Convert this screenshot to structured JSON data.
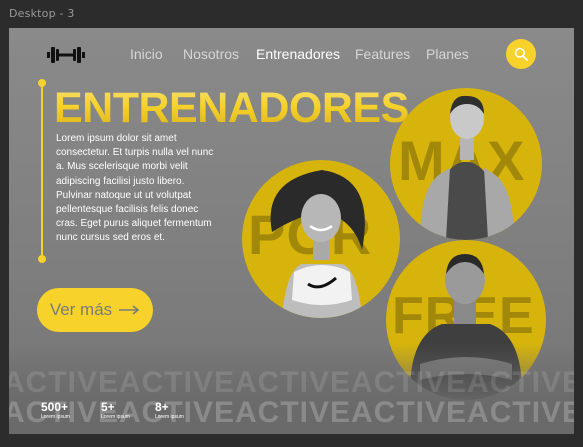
{
  "frame_label": "Desktop - 3",
  "colors": {
    "accent": "#f7d22a",
    "circle": "#d6b40c",
    "background": "#808080"
  },
  "header": {
    "logo_icon": "dumbbell-icon",
    "nav": [
      {
        "label": "Inicio"
      },
      {
        "label": "Nosotros"
      },
      {
        "label": "Entrenadores",
        "active": true
      },
      {
        "label": "Features"
      },
      {
        "label": "Planes"
      }
    ],
    "search_icon": "search-icon"
  },
  "hero": {
    "title": "ENTRENADORES",
    "body": "Lorem ipsum dolor sit amet consectetur. Et turpis nulla vel nunc a. Mus scelerisque morbi velit adipiscing facilisi justo libero. Pulvinar natoque ut ut volutpat pellentesque facilisis felis donec cras. Eget purus aliquet fermentum nunc cursus sed eros et.",
    "cta_label": "Ver más",
    "cta_icon": "arrow-right-icon"
  },
  "trainers": [
    {
      "word": "MAX"
    },
    {
      "word": "POR"
    },
    {
      "word": "FREE"
    }
  ],
  "marquee_text": "ACTIVEACTIVEACTIVEACTIVEACTIVEACTI",
  "stats": [
    {
      "value": "500+",
      "label": "Lorem ipsum"
    },
    {
      "value": "5+",
      "label": "Lorem ipsum"
    },
    {
      "value": "8+",
      "label": "Lorem ipsum"
    }
  ]
}
